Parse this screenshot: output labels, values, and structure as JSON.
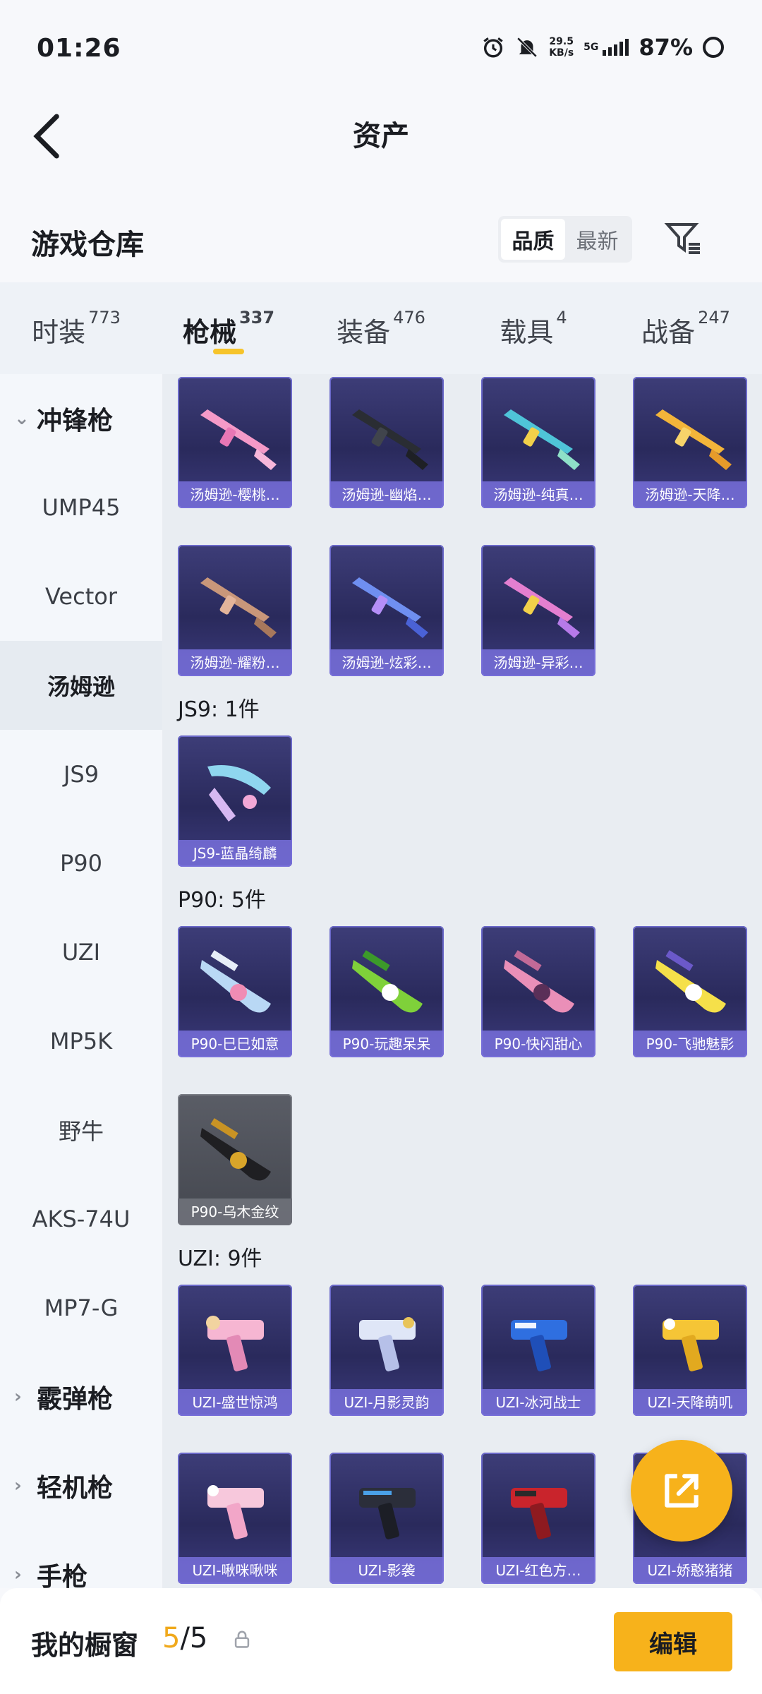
{
  "status": {
    "time": "01:26",
    "net_speed": "29.5",
    "net_unit": "KB/s",
    "network": "5G",
    "battery": "87%"
  },
  "nav": {
    "title": "资产"
  },
  "header": {
    "title": "游戏仓库",
    "sort_quality": "品质",
    "sort_newest": "最新"
  },
  "tabs": [
    {
      "label": "时装",
      "count": "773"
    },
    {
      "label": "枪械",
      "count": "337"
    },
    {
      "label": "装备",
      "count": "476"
    },
    {
      "label": "载具",
      "count": "4"
    },
    {
      "label": "战备",
      "count": "247"
    }
  ],
  "sidebar": {
    "group_open": "冲锋枪",
    "items": [
      "UMP45",
      "Vector",
      "汤姆逊",
      "JS9",
      "P90",
      "UZI",
      "MP5K",
      "野牛",
      "AKS-74U",
      "MP7-G"
    ],
    "groups_closed": [
      "霰弹枪",
      "轻机枪",
      "手枪"
    ]
  },
  "sections": {
    "thompson": [
      "汤姆逊-樱桃…",
      "汤姆逊-幽焰…",
      "汤姆逊-纯真…",
      "汤姆逊-天降…",
      "汤姆逊-耀粉…",
      "汤姆逊-炫彩…",
      "汤姆逊-异彩…"
    ],
    "js9_title": "JS9: 1件",
    "js9": [
      "JS9-蓝晶绮麟"
    ],
    "p90_title": "P90: 5件",
    "p90": [
      "P90-巳巳如意",
      "P90-玩趣呆呆",
      "P90-快闪甜心",
      "P90-飞驰魅影",
      "P90-乌木金纹"
    ],
    "uzi_title": "UZI: 9件",
    "uzi": [
      "UZI-盛世惊鸿",
      "UZI-月影灵韵",
      "UZI-冰河战士",
      "UZI-天降萌叽",
      "UZI-啾咪啾咪",
      "UZI-影袭",
      "UZI-红色方…",
      "UZI-娇憨猪猪"
    ]
  },
  "bottom": {
    "label": "我的橱窗",
    "current": "5",
    "total": "/5",
    "edit": "编辑"
  },
  "colors": {
    "accent": "#f7b21b",
    "card_bg": "#2f2f66",
    "card_label": "#7870dc"
  },
  "icons": [
    "back-arrow-icon",
    "filter-icon",
    "share-icon",
    "lock-icon",
    "alarm-icon",
    "mute-icon"
  ]
}
